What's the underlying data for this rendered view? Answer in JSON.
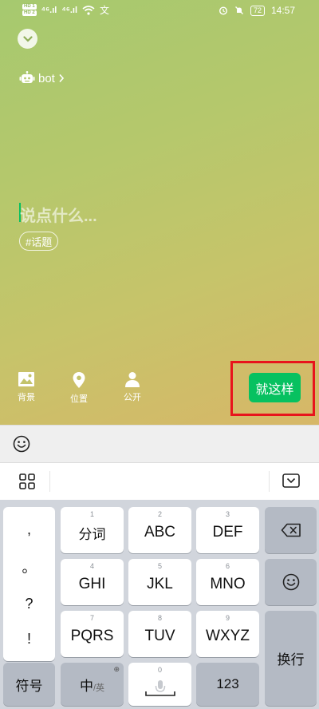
{
  "status_bar": {
    "sim1": "HD 1",
    "sim2": "HD 2",
    "signal1": "⁴⁶.ıl",
    "signal2": "⁴⁶.ıl",
    "battery": "72",
    "time": "14:57"
  },
  "compose": {
    "bot_label": "bot",
    "placeholder": "说点什么...",
    "topic_chip": "#话题",
    "tools": {
      "background": "背景",
      "location": "位置",
      "visibility": "公开"
    },
    "submit_label": "就这样"
  },
  "keyboard": {
    "punctuation": [
      ",",
      "。",
      "?",
      "!"
    ],
    "keys": [
      {
        "num": "1",
        "label": "分词"
      },
      {
        "num": "2",
        "label": "ABC"
      },
      {
        "num": "3",
        "label": "DEF"
      },
      {
        "num": "4",
        "label": "GHI"
      },
      {
        "num": "5",
        "label": "JKL"
      },
      {
        "num": "6",
        "label": "MNO"
      },
      {
        "num": "7",
        "label": "PQRS"
      },
      {
        "num": "8",
        "label": "TUV"
      },
      {
        "num": "9",
        "label": "WXYZ"
      }
    ],
    "symbols_label": "符号",
    "lang_main": "中",
    "lang_alt": "/英",
    "space_num": "0",
    "numbers_label": "123",
    "newline_label": "换行"
  },
  "icons": {
    "collapse": "chevron-down-icon",
    "bot": "robot-icon",
    "background": "image-icon",
    "location": "location-pin-icon",
    "visibility": "person-icon",
    "emoji": "smiley-icon",
    "keyboard_menu": "grid-icon",
    "hide_keyboard": "keyboard-hide-icon",
    "backspace": "backspace-icon",
    "microphone": "mic-icon"
  },
  "colors": {
    "accent_green": "#07c160",
    "highlight_red": "#e8141c"
  }
}
